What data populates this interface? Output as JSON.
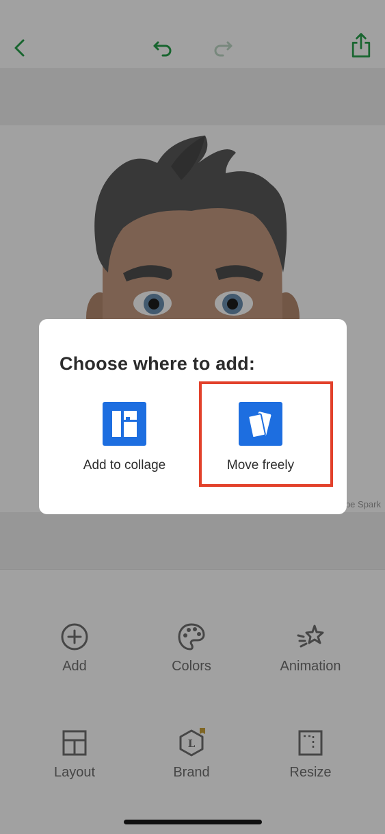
{
  "toolbar": {
    "back_icon": "chevron-left-icon",
    "undo_icon": "undo-icon",
    "redo_icon": "redo-icon",
    "share_icon": "share-icon",
    "accent_color": "#27a04b"
  },
  "canvas": {
    "watermark": "be Spark"
  },
  "dialog": {
    "title": "Choose where to add:",
    "options": [
      {
        "label": "Add to collage",
        "icon": "collage-icon"
      },
      {
        "label": "Move freely",
        "icon": "cards-icon",
        "highlighted": true
      }
    ],
    "highlight_color": "#e2412b",
    "tile_color": "#1d6ee0"
  },
  "tools": [
    {
      "label": "Add",
      "icon": "plus-circle-icon"
    },
    {
      "label": "Colors",
      "icon": "palette-icon"
    },
    {
      "label": "Animation",
      "icon": "animation-star-icon"
    },
    {
      "label": "Layout",
      "icon": "layout-grid-icon"
    },
    {
      "label": "Brand",
      "icon": "brand-badge-icon"
    },
    {
      "label": "Resize",
      "icon": "resize-icon"
    }
  ]
}
